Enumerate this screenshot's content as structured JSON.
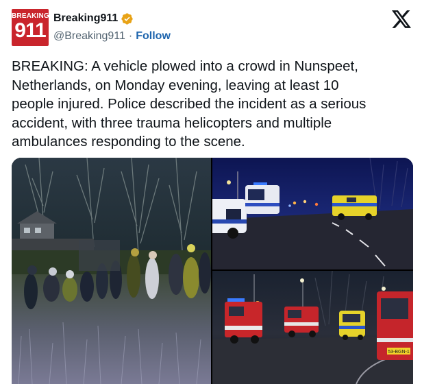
{
  "author": {
    "avatar_text_top": "BREAKING",
    "avatar_text_number": "911",
    "display_name": "Breaking911",
    "handle": "@Breaking911",
    "separator": "·",
    "follow_label": "Follow",
    "verified": true,
    "verified_color": "#e8a317"
  },
  "platform": {
    "logo_icon": "x-logo-icon"
  },
  "tweet": {
    "text_lines": [
      "BREAKING: A vehicle plowed into a crowd in Nunspeet,",
      "Netherlands, on Monday evening, leaving at least 10",
      "people injured. Police described the incident as a serious",
      "accident, with three trauma helicopters and multiple",
      "ambulances responding to the scene."
    ]
  },
  "media": {
    "photo_count": 3,
    "vehicle_plates": [
      "53-BGN-1"
    ]
  },
  "colors": {
    "link": "#1d64ad",
    "text": "#0f1419",
    "secondary": "#536471",
    "brand_red": "#c9252c"
  }
}
